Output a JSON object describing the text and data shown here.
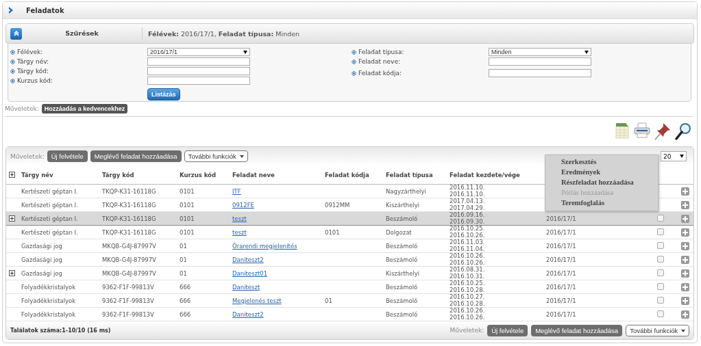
{
  "header": {
    "title": "Feladatok"
  },
  "filter_panel": {
    "title": "Szűrések",
    "summary": "**Félévek:** 2016/17/1, **Feladat típusa:** Minden",
    "expanded": true
  },
  "filters_left": [
    {
      "label": "Félévek:",
      "kind": "select",
      "value": "2016/17/1"
    },
    {
      "label": "Tárgy név:",
      "kind": "text"
    },
    {
      "label": "Tárgy kód:",
      "kind": "text"
    },
    {
      "label": "Kurzus kód:",
      "kind": "text"
    }
  ],
  "filters_right": [
    {
      "label": "Feladat típusa:",
      "kind": "select",
      "value": "Minden"
    },
    {
      "label": "Feladat neve:",
      "kind": "text"
    },
    {
      "label": "Feladat kódja:",
      "kind": "text"
    }
  ],
  "list_button": "Listázás",
  "favorites": {
    "label": "Műveletek:",
    "button": "Hozzáadás a kedvencekhez"
  },
  "toolbar": {
    "label": "Műveletek:",
    "buttons": [
      {
        "label": "Új felvétele",
        "kind": "dark"
      },
      {
        "label": "Meglévő feladat hozzáadása",
        "kind": "dark"
      },
      {
        "label": "További funkciók",
        "kind": "dropdown"
      }
    ],
    "page_size": "20"
  },
  "table": {
    "columns": [
      "Tárgy név",
      "Tárgy kód",
      "Kurzus kód",
      "Feladat neve",
      "Feladat kódja",
      "Feladat típusa",
      "Feladat kezdete/vége"
    ],
    "rows": [
      {
        "subject": "Kertészeti géptan I.",
        "code": "TKQP-K31-16118G",
        "course": "0101",
        "task": "JTF",
        "task_code": "",
        "type": "Nagyzárthelyi",
        "start": "2016.11.10.",
        "end": "2016.11.10.",
        "expandable": false,
        "selected": false
      },
      {
        "subject": "Kertészeti géptan I.",
        "code": "TKQP-K31-16118G",
        "course": "0101",
        "task": "0912FE",
        "task_code": "0912MM",
        "type": "Kiszárthelyi",
        "start": "2017.04.13.",
        "end": "2017.04.29.",
        "expandable": false,
        "selected": false
      },
      {
        "subject": "Kertészeti géptan I.",
        "code": "TKQP-K31-16118G",
        "course": "0101",
        "task": "teszt",
        "task_code": "",
        "type": "Beszámoló",
        "start": "2016.09.16.",
        "end": "2016.09.30.",
        "semester": "2016/17/1",
        "checked": false,
        "expandable": true,
        "selected": true
      },
      {
        "subject": "Kertészeti géptan I.",
        "code": "TKQP-K31-16118G",
        "course": "0101",
        "task": "teszt",
        "task_code": "0101",
        "type": "Dolgozat",
        "start": "2016.10.25.",
        "end": "2016.10.26.",
        "semester": "2016/17/1",
        "checked": false,
        "expandable": false,
        "selected": false
      },
      {
        "subject": "Gazdasági jog",
        "code": "MKQB-G4J-87997V",
        "course": "01",
        "task": "Órarendi megjelenítés",
        "task_code": "",
        "type": "Beszámoló",
        "start": "2016.11.03.",
        "end": "2016.11.04.",
        "semester": "2016/17/1",
        "checked": false,
        "expandable": false,
        "selected": false
      },
      {
        "subject": "Gazdasági jog",
        "code": "MKQB-G4J-87997V",
        "course": "01",
        "task": "Daniteszt2",
        "task_code": "",
        "type": "Beszámoló",
        "start": "2016.10.26.",
        "end": "2016.10.26.",
        "semester": "2016/17/1",
        "checked": false,
        "expandable": false,
        "selected": false
      },
      {
        "subject": "Gazdasági jog",
        "code": "MKQB-G4J-87997V",
        "course": "01",
        "task": "Daniteszt01",
        "task_code": "",
        "type": "Kiszárthelyi",
        "start": "2016.08.31.",
        "end": "2016.10.31.",
        "semester": "2016/17/1",
        "checked": false,
        "expandable": true,
        "selected": false
      },
      {
        "subject": "Folyadékkristalyok",
        "code": "9362-F1F-99813V",
        "course": "666",
        "task": "Daniteszt",
        "task_code": "",
        "type": "Beszámoló",
        "start": "2016.10.25.",
        "end": "2016.10.28.",
        "semester": "2016/17/1",
        "checked": false,
        "expandable": false,
        "selected": false
      },
      {
        "subject": "Folyadékkristalyok",
        "code": "9362-F1F-99813V",
        "course": "666",
        "task": "Megjelenés teszt",
        "task_code": "01",
        "type": "Beszámoló",
        "start": "2016.10.27.",
        "end": "2016.10.28.",
        "semester": "2016/17/1",
        "checked": false,
        "expandable": false,
        "selected": false
      },
      {
        "subject": "Folyadékkristalyok",
        "code": "9362-F1F-99813V",
        "course": "666",
        "task": "Daniteszt2",
        "task_code": "",
        "type": "Beszámoló",
        "start": "2016.10.26.",
        "end": "2016.10.26.",
        "semester": "2016/17/1",
        "checked": false,
        "expandable": false,
        "selected": false
      }
    ]
  },
  "context_menu": [
    {
      "label": "Szerkesztés",
      "disabled": false
    },
    {
      "label": "Eredmények",
      "disabled": false
    },
    {
      "label": "Részfeladat hozzáadása",
      "disabled": false
    },
    {
      "label": "Pótlás hozzáadása",
      "disabled": true
    },
    {
      "label": "Teremfoglalás",
      "disabled": false
    }
  ],
  "footer": {
    "count": "Találatok száma:1-10/10 (16 ms)",
    "label": "Műveletek:",
    "buttons": [
      {
        "label": "Új felvétele",
        "kind": "dark"
      },
      {
        "label": "Meglévő feladat hozzáadása",
        "kind": "dark"
      },
      {
        "label": "További funkciók",
        "kind": "dropdown"
      }
    ]
  }
}
